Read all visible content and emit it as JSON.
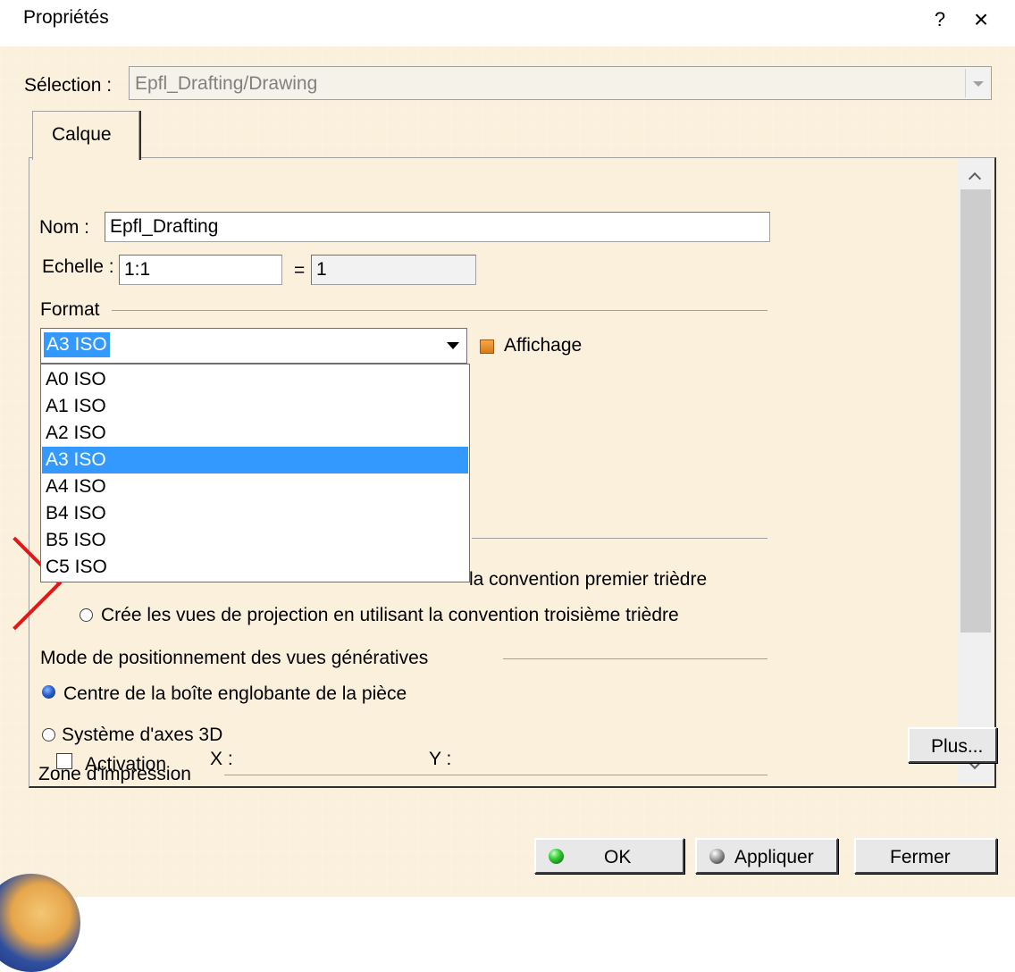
{
  "window": {
    "title": "Propriétés",
    "help_label": "?",
    "close_label": "×"
  },
  "selection": {
    "label": "Sélection :",
    "value": "Epfl_Drafting/Drawing"
  },
  "tabs": [
    {
      "label": "Calque"
    }
  ],
  "layer": {
    "name_label": "Nom :",
    "name_value": "Epfl_Drafting",
    "scale_label": "Echelle :",
    "scale_value": "1:1",
    "equals_label": "=",
    "scale_result": "1"
  },
  "format": {
    "group_label": "Format",
    "selected": "A3 ISO",
    "options": [
      "A0 ISO",
      "A1 ISO",
      "A2 ISO",
      "A3 ISO",
      "A4 ISO",
      "B4 ISO",
      "B5 ISO",
      "C5 ISO"
    ],
    "selected_index": 3,
    "display_label": "Affichage"
  },
  "projection": {
    "first_option_partial": "la convention premier trièdre",
    "third_option": "Crée les vues de projection en utilisant la convention troisième trièdre"
  },
  "positioning": {
    "group_label": "Mode de positionnement des vues génératives",
    "option_bbox": "Centre de la boîte englobante de la pièce",
    "option_axes": "Système d'axes 3D"
  },
  "print_zone": {
    "group_label": "Zone d'impression",
    "activation_label": "Activation",
    "x_label": "X :",
    "y_label": "Y :"
  },
  "buttons": {
    "more": "Plus...",
    "ok": "OK",
    "apply": "Appliquer",
    "close": "Fermer"
  },
  "colors": {
    "dialog_bg": "#faf0dc",
    "selection_highlight": "#3399ff",
    "annotation_red": "#e01818"
  }
}
